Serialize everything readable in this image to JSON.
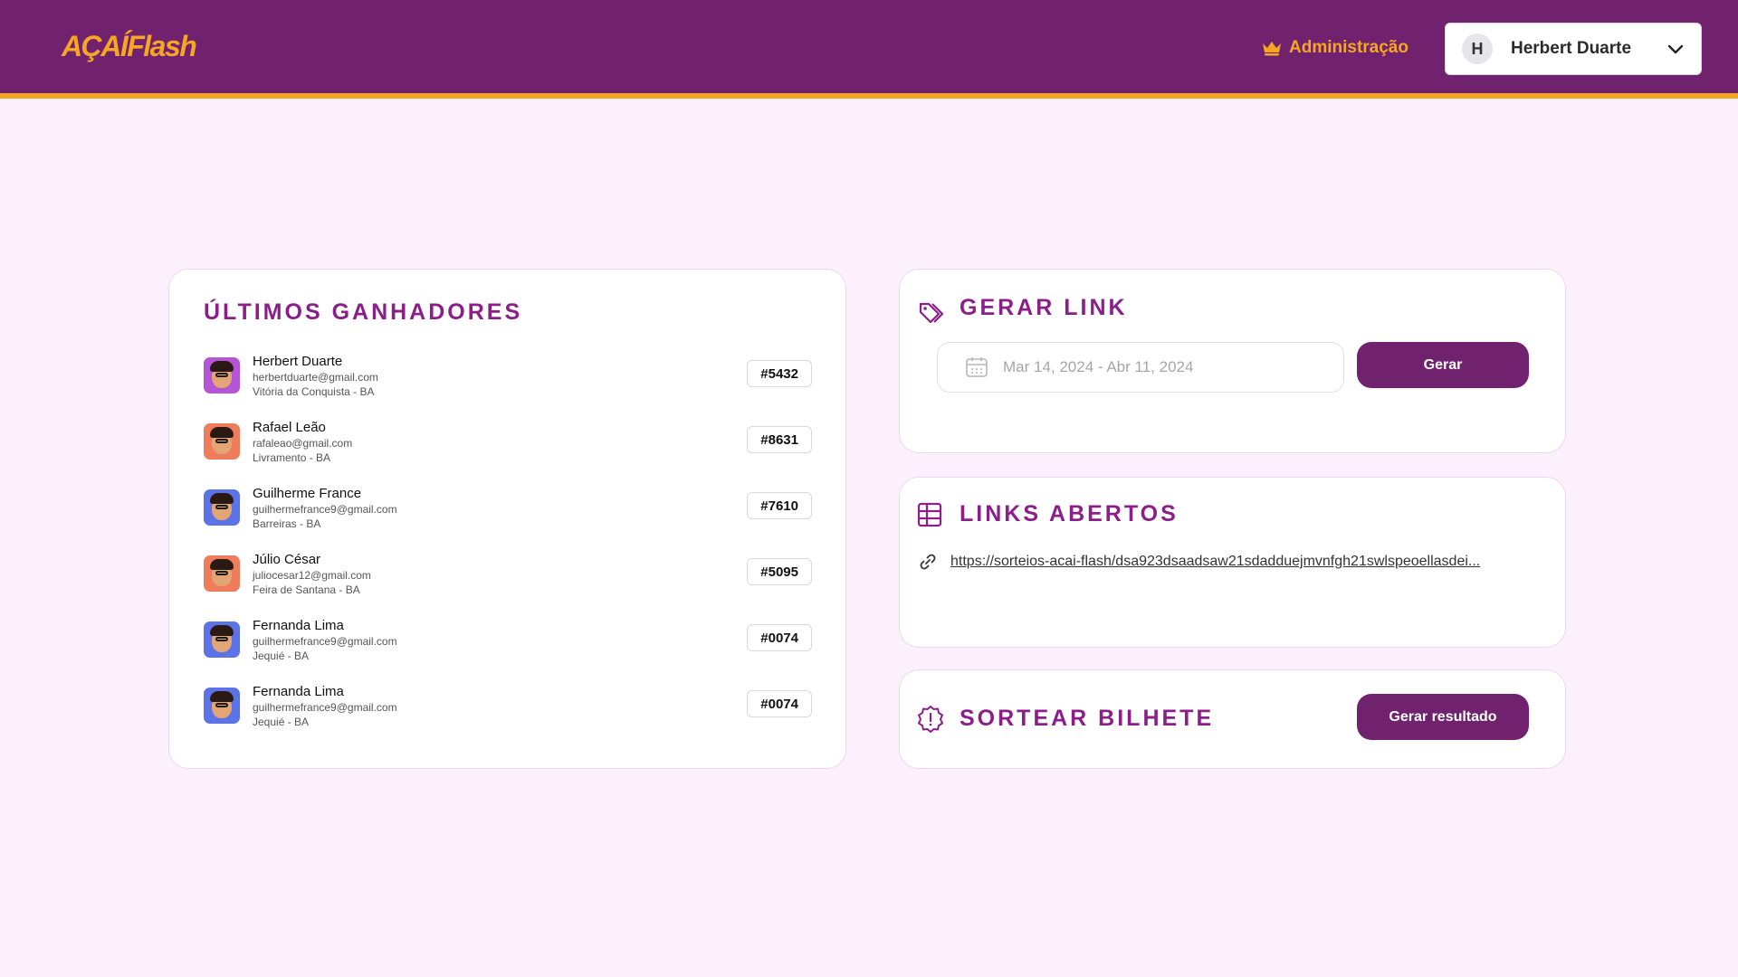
{
  "header": {
    "logo": "AÇAÍFlash",
    "admin_label": "Administração",
    "admin_icon": "crown-icon",
    "user": {
      "initial": "H",
      "name": "Herbert Duarte"
    }
  },
  "colors": {
    "header_bg": "#71226f",
    "accent": "#f5a623",
    "title": "#8b1e88",
    "page_bg": "#fdf0fd",
    "button": "#71226f"
  },
  "winners": {
    "title": "ÚLTIMOS GANHADORES",
    "items": [
      {
        "name": "Herbert Duarte",
        "email": "herbertduarte@gmail.com",
        "city": "Vitória da Conquista - BA",
        "ticket": "#5432",
        "avatar_bg": "#b455d6"
      },
      {
        "name": "Rafael Leão",
        "email": "rafaleao@gmail.com",
        "city": "Livramento - BA",
        "ticket": "#8631",
        "avatar_bg": "#ef7d5c"
      },
      {
        "name": "Guilherme France",
        "email": "guilhermefrance9@gmail.com",
        "city": "Barreiras - BA",
        "ticket": "#7610",
        "avatar_bg": "#5c73e8"
      },
      {
        "name": "Júlio César",
        "email": "juliocesar12@gmail.com",
        "city": "Feira de Santana - BA",
        "ticket": "#5095",
        "avatar_bg": "#ef7d5c"
      },
      {
        "name": "Fernanda Lima",
        "email": "guilhermefrance9@gmail.com",
        "city": "Jequié - BA",
        "ticket": "#0074",
        "avatar_bg": "#5c73e8"
      },
      {
        "name": "Fernanda Lima",
        "email": "guilhermefrance9@gmail.com",
        "city": "Jequié - BA",
        "ticket": "#0074",
        "avatar_bg": "#5c73e8"
      }
    ]
  },
  "gerar_link": {
    "title": "GERAR LINK",
    "icon": "tags-icon",
    "date_placeholder": "Mar 14, 2024 - Abr 11, 2024",
    "button_label": "Gerar"
  },
  "links_abertos": {
    "title": "LINKS ABERTOS",
    "icon": "table-icon",
    "link": "https://sorteios-acai-flash/dsa923dsaadsaw21sdadduejmvnfgh21swlspeoellasdei..."
  },
  "sortear": {
    "title": "SORTEAR BILHETE",
    "icon": "alert-badge-icon",
    "button_label": "Gerar resultado"
  }
}
